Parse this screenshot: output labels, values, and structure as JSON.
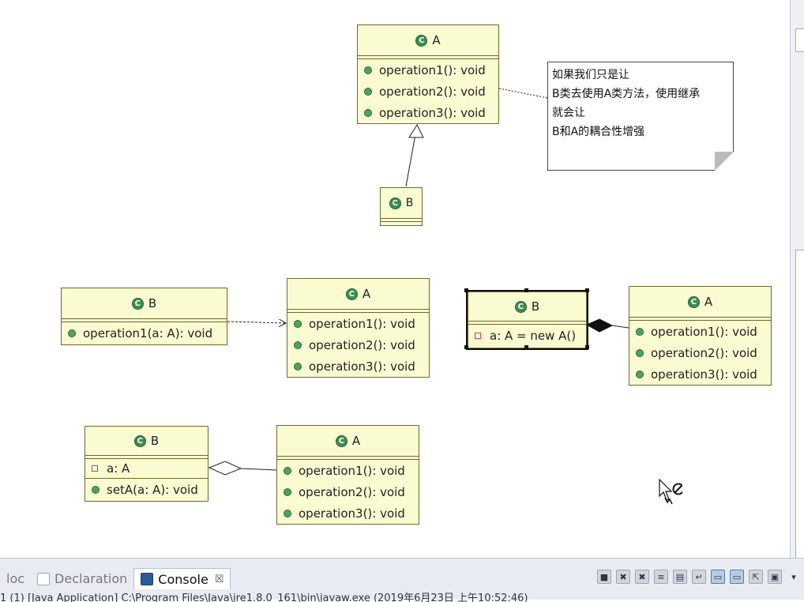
{
  "classes": {
    "topA": {
      "name": "A",
      "ops": [
        "operation1(): void",
        "operation2(): void",
        "operation3(): void"
      ]
    },
    "topB": {
      "name": "B"
    },
    "depB": {
      "name": "B",
      "ops": [
        "operation1(a: A): void"
      ]
    },
    "depA": {
      "name": "A",
      "ops": [
        "operation1(): void",
        "operation2(): void",
        "operation3(): void"
      ]
    },
    "compB": {
      "name": "B",
      "attrs": [
        "a: A = new A()"
      ]
    },
    "compA": {
      "name": "A",
      "ops": [
        "operation1(): void",
        "operation2(): void",
        "operation3(): void"
      ]
    },
    "aggB": {
      "name": "B",
      "attrs": [
        "a: A"
      ],
      "ops": [
        "setA(a: A): void"
      ]
    },
    "aggA": {
      "name": "A",
      "ops": [
        "operation1(): void",
        "operation2(): void",
        "operation3(): void"
      ]
    }
  },
  "class_icon": "C",
  "note": {
    "lines": [
      "如果我们只是让",
      "B类去使用A类方法，使用继承",
      "就会让",
      "B和A的耦合性增强"
    ]
  },
  "bottom": {
    "tabs": [
      {
        "label": "loc",
        "icon": "javadoc-icon"
      },
      {
        "label": "Declaration",
        "icon": "declaration-icon"
      },
      {
        "label": "Console",
        "icon": "console-icon",
        "active": true
      }
    ],
    "close_glyph": "☒",
    "status_text": "1 (1) [Java Application] C:\\Program Files\\Java\\jre1.8.0_161\\bin\\javaw.exe (2019年6月23日 上午10:52:46)"
  },
  "colors": {
    "class_fill": "#fbfbd2",
    "class_border": "#6b6b2f",
    "icon_green": "#3e8e52"
  }
}
